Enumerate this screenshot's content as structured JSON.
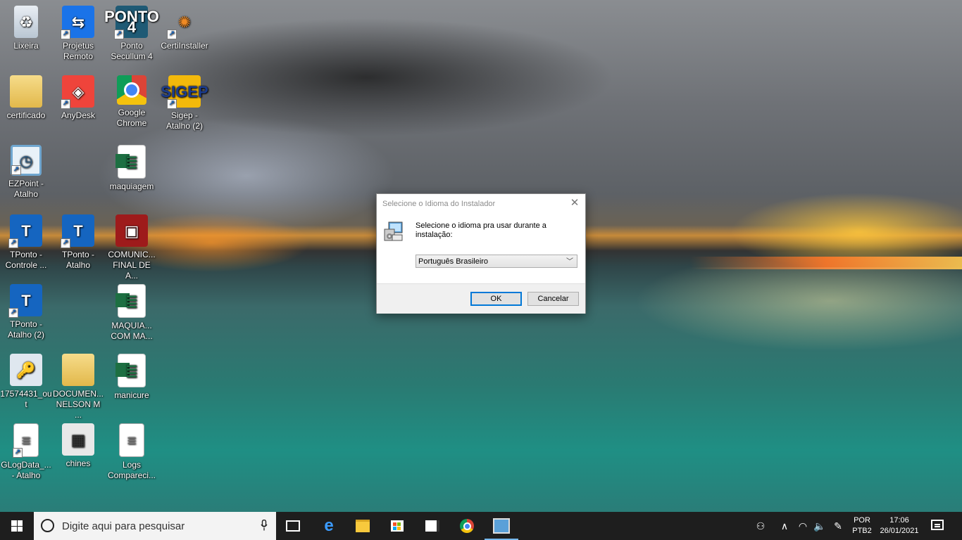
{
  "desktop": {
    "icons": [
      {
        "label": "Lixeira",
        "icon": "recycle-bin-icon"
      },
      {
        "label": "Projetus Remoto",
        "icon": "teamviewer-icon"
      },
      {
        "label": "Ponto Secullum 4",
        "icon": "ponto-secullum-icon",
        "glyph": "PONTO 4"
      },
      {
        "label": "CertiInstaller",
        "icon": "certiinstaller-icon"
      },
      {
        "label": "certificado",
        "icon": "folder-icon"
      },
      {
        "label": "AnyDesk",
        "icon": "anydesk-icon"
      },
      {
        "label": "Google Chrome",
        "icon": "chrome-icon"
      },
      {
        "label": "Sigep - Atalho (2)",
        "icon": "sigep-icon",
        "glyph": "SIGEP"
      },
      {
        "label": "EZPoint - Atalho",
        "icon": "clock-icon"
      },
      {
        "label": "maquiagem",
        "icon": "excel-icon"
      },
      {
        "label": "TPonto - Controle ...",
        "icon": "tponto-icon"
      },
      {
        "label": "TPonto - Atalho",
        "icon": "tponto-icon"
      },
      {
        "label": "COMUNIC... FINAL DE A...",
        "icon": "image-file-icon"
      },
      {
        "label": "TPonto - Atalho (2)",
        "icon": "tponto-icon"
      },
      {
        "label": "MAQUIA... COM MA...",
        "icon": "excel-icon"
      },
      {
        "label": "17574431_out",
        "icon": "certificate-file-icon"
      },
      {
        "label": "DOCUMEN... NELSON M ...",
        "icon": "folder-icon"
      },
      {
        "label": "manicure",
        "icon": "excel-icon"
      },
      {
        "label": "GLogData_... - Atalho",
        "icon": "text-file-icon"
      },
      {
        "label": "chines",
        "icon": "image-file-icon"
      },
      {
        "label": "Logs Compareci...",
        "icon": "text-file-icon"
      }
    ]
  },
  "dialog": {
    "title": "Selecione o Idioma do Instalador",
    "prompt": "Selecione o idioma pra usar durante a instalação:",
    "selected_language": "Português Brasileiro",
    "ok_label": "OK",
    "cancel_label": "Cancelar"
  },
  "taskbar": {
    "search_placeholder": "Digite aqui para pesquisar",
    "language_line1": "POR",
    "language_line2": "PTB2",
    "time": "17:06",
    "date": "26/01/2021"
  },
  "colors": {
    "taskbar_bg": "#1e1e1e",
    "accent": "#0078d7"
  }
}
